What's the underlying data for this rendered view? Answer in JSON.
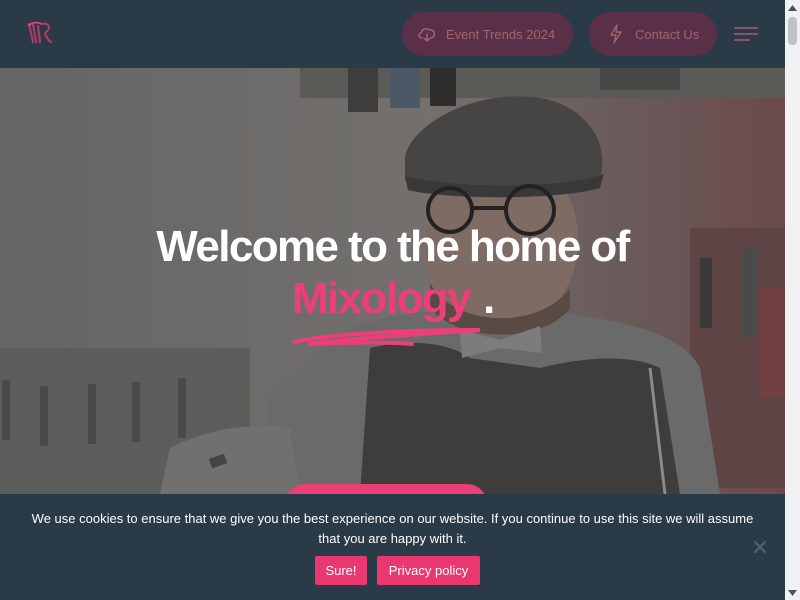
{
  "header": {
    "logo": {
      "icon": "mixology-logo-icon"
    },
    "buttons": [
      {
        "label": "Event Trends 2024",
        "icon": "cloud-download-icon"
      },
      {
        "label": "Contact Us",
        "icon": "lightning-bolt-icon"
      }
    ],
    "menu": {
      "icon": "hamburger-menu-icon"
    }
  },
  "hero": {
    "title_line1": "Welcome to the home of",
    "accent_word": "Mixology",
    "punctuation": ".",
    "cta_label": ""
  },
  "cookie_banner": {
    "message": "We use cookies to ensure that we give you the best experience on our website. If you continue to use this site we will assume that you are happy with it.",
    "accept_label": "Sure!",
    "privacy_label": "Privacy policy",
    "close_icon": "close-icon"
  },
  "colors": {
    "header_bg": "#2a3a47",
    "pill_bg": "#5a2f48",
    "pill_text": "#a2646f",
    "accent": "#ec3f78",
    "cookie_button": "#e8386f"
  }
}
